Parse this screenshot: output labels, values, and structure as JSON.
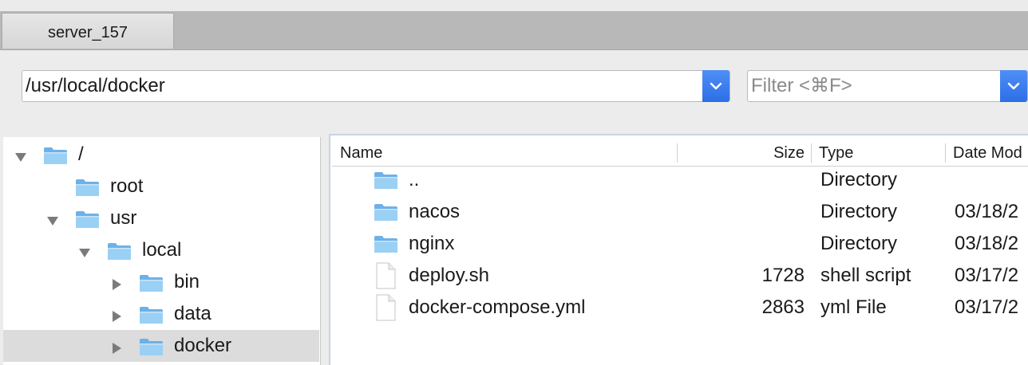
{
  "tabs": [
    {
      "label": "server_157"
    }
  ],
  "path": {
    "value": "/usr/local/docker"
  },
  "filter": {
    "placeholder": "Filter <⌘F>"
  },
  "tree": [
    {
      "label": "/",
      "expanded": true,
      "level": 0
    },
    {
      "label": "root",
      "expanded": null,
      "level": 1
    },
    {
      "label": "usr",
      "expanded": true,
      "level": 1
    },
    {
      "label": "local",
      "expanded": true,
      "level": 2
    },
    {
      "label": "bin",
      "expanded": false,
      "level": 3
    },
    {
      "label": "data",
      "expanded": false,
      "level": 3
    },
    {
      "label": "docker",
      "expanded": false,
      "level": 3,
      "selected": true
    }
  ],
  "list": {
    "columns": {
      "name": "Name",
      "size": "Size",
      "type": "Type",
      "date": "Date Mod"
    },
    "rows": [
      {
        "name": "..",
        "icon": "folder-icon",
        "size": "",
        "type": "Directory",
        "date": ""
      },
      {
        "name": "nacos",
        "icon": "folder-icon",
        "size": "",
        "type": "Directory",
        "date": "03/18/2"
      },
      {
        "name": "nginx",
        "icon": "folder-icon",
        "size": "",
        "type": "Directory",
        "date": "03/18/2"
      },
      {
        "name": "deploy.sh",
        "icon": "file-icon",
        "size": "1728",
        "type": "shell script",
        "date": "03/17/2"
      },
      {
        "name": "docker-compose.yml",
        "icon": "file-icon",
        "size": "2863",
        "type": "yml File",
        "date": "03/17/2"
      }
    ]
  },
  "colors": {
    "accent": "#2b6fe6",
    "folder": "#8ec5ef",
    "selection": "#dcdcdc"
  }
}
